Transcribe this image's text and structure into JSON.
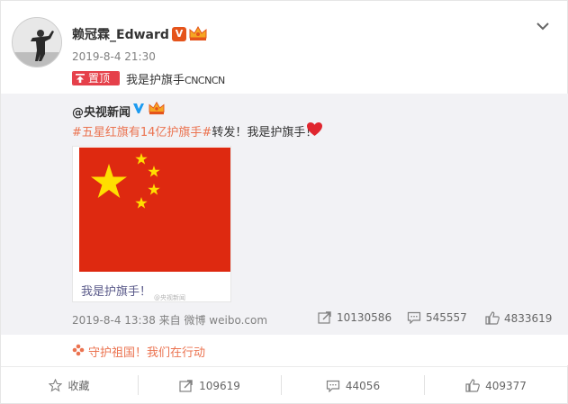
{
  "post": {
    "username": "赖冠霖_Edward",
    "verified_badge": "V",
    "timestamp": "2019-8-4 21:30",
    "pin_label": "置顶",
    "text_main": "我是护旗手",
    "text_suffix": "CNCNCN",
    "menu_icon": "chevron-down-icon"
  },
  "repost": {
    "original_user": "@央视新闻",
    "hashtag": "#五星红旗有14亿护旗手#",
    "text_after": "转发！我是护旗手！",
    "image_caption": "我是护旗手！",
    "image_watermark": "@央视新闻",
    "meta": "2019-8-4 13:38 来自 微博 weibo.com",
    "reposts": "10130586",
    "comments": "545557",
    "likes": "4833619"
  },
  "topic": {
    "text": "守护祖国！我们在行动"
  },
  "actions": {
    "favorite_label": "收藏",
    "repost_count": "109619",
    "comment_count": "44056",
    "like_count": "409377"
  },
  "colors": {
    "accent": "#eb7350",
    "flag_red": "#de2910",
    "flag_star": "#ffde00",
    "pin_red": "#e5404a",
    "verified_orange": "#e5541b",
    "verified_blue": "#1d9bf0"
  }
}
